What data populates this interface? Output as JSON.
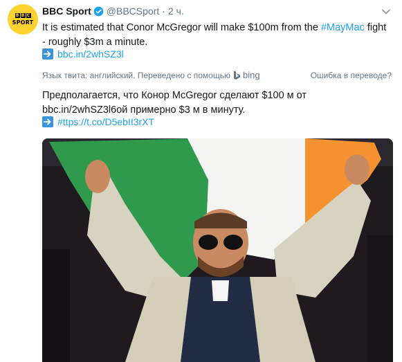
{
  "avatar": {
    "letters": [
      "B",
      "B",
      "C"
    ],
    "sport": "SPORT"
  },
  "header": {
    "name": "BBC Sport",
    "handle": "@BBCSport",
    "dot": "·",
    "time": "2 ч."
  },
  "tweet": {
    "text_before": "It is estimated that Conor McGregor will make $100m from the ",
    "hashtag": "#MayMac",
    "text_after": " fight - roughly $3m a minute.",
    "link": "bbc.in/2whSZ3l"
  },
  "translation": {
    "label": "Язык твита: английский. Переведено с помощью",
    "provider": "bing",
    "error_link": "Ошибка в переводе?",
    "text_before": "Предполагается, что Конор McGregor сделают $100 м от ",
    "inline_link": "bbc.in/2whSZ3l6ой",
    "text_after": " примерно $3 м в минуту.",
    "link": "#ttps://t.co/D5ebII3rXT"
  },
  "colors": {
    "accent": "#1da1f2",
    "secondary": "#657786",
    "bbc_yellow": "#ffd230"
  }
}
